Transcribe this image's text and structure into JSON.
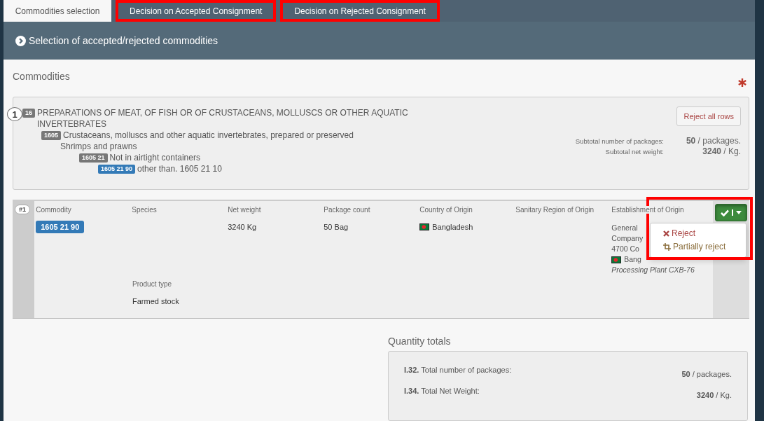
{
  "tabs": [
    {
      "label": "Commodities selection",
      "selected": true,
      "highlighted": false
    },
    {
      "label": "Decision on Accepted Consignment",
      "selected": false,
      "highlighted": true
    },
    {
      "label": "Decision on Rejected Consignment",
      "selected": false,
      "highlighted": true
    }
  ],
  "section_header": {
    "title": "Selection of accepted/rejected commodities"
  },
  "commodities": {
    "title": "Commodities",
    "group": {
      "number": "1",
      "tree": [
        {
          "code": "16",
          "label": "PREPARATIONS OF MEAT, OF FISH OR OF CRUSTACEANS, MOLLUSCS OR OTHER AQUATIC INVERTEBRATES",
          "selected": false,
          "children": [
            {
              "code": "1605",
              "label": "Crustaceans, molluscs and other aquatic invertebrates, prepared or preserved",
              "selected": false,
              "children": [
                {
                  "label": "Shrimps and prawns",
                  "children": [
                    {
                      "code": "1605 21",
                      "label": "Not in airtight containers",
                      "selected": false,
                      "children": [
                        {
                          "code": "1605 21 90",
                          "label": "other than. 1605 21 10",
                          "selected": true
                        }
                      ]
                    }
                  ]
                }
              ]
            }
          ]
        }
      ],
      "reject_all_button": "Reject all rows",
      "subtotals": [
        {
          "label": "Subtotal number of packages:",
          "amount": "50",
          "unit": "/ packages."
        },
        {
          "label": "Subtotal net weight:",
          "amount": "3240",
          "unit": "/ Kg."
        }
      ]
    },
    "rows": [
      {
        "number": "#1",
        "fields": [
          {
            "label": "Commodity",
            "kind": "badge",
            "value": "1605 21 90"
          },
          {
            "label": "Species",
            "kind": "text"
          },
          {
            "label": "Net weight",
            "kind": "text",
            "value": "3240 Kg"
          },
          {
            "label": "Package count",
            "kind": "text",
            "value": "50 Bag"
          },
          {
            "label": "Country of Origin",
            "kind": "flag",
            "value": "Bangladesh"
          },
          {
            "label": "Sanitary Region of Origin",
            "kind": "text"
          },
          {
            "label": "Establishment of Origin",
            "kind": "lines",
            "lines": [
              {
                "kind": "text",
                "text": "General"
              },
              {
                "kind": "text",
                "text": "Company"
              },
              {
                "kind": "text",
                "text": "4700 Co"
              },
              {
                "kind": "flag",
                "text": "Bang"
              },
              {
                "kind": "italic",
                "text": "Processing Plant CXB-76"
              }
            ]
          }
        ],
        "extra_fields": [
          {
            "label": "Product type",
            "value": "Farmed stock"
          }
        ],
        "action_menu": {
          "expanded": true,
          "highlighted": true,
          "items": [
            {
              "kind": "reject",
              "label": "Reject"
            },
            {
              "kind": "partial",
              "label": "Partially reject"
            }
          ]
        }
      }
    ]
  },
  "quantity_totals": {
    "title": "Quantity totals",
    "rows": [
      {
        "code": "I.32.",
        "label": "Total number of packages:",
        "amount": "50",
        "unit": "/ packages."
      },
      {
        "code": "I.34.",
        "label": "Total Net Weight:",
        "amount": "3240",
        "unit": "/ Kg."
      }
    ]
  }
}
